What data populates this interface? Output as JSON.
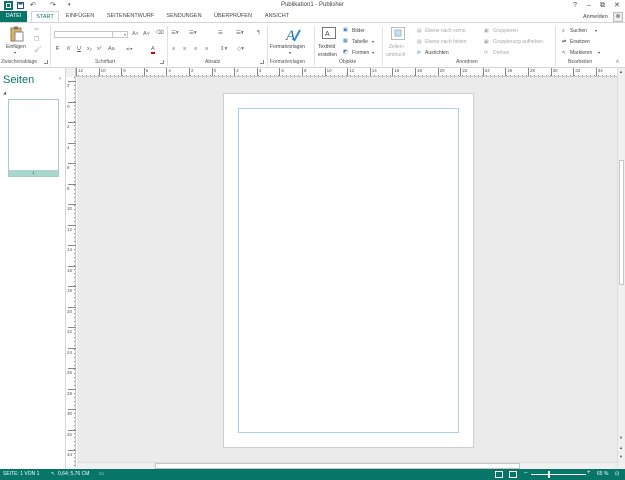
{
  "window": {
    "title": "Publikation1 - Publisher",
    "controls": {
      "help": "?",
      "minimize": "–",
      "restore": "⧉",
      "close": "✕"
    }
  },
  "quick_access": {
    "undo": "↶",
    "redo": "↷",
    "customize": "▾"
  },
  "tabs": [
    {
      "label": "DATEI"
    },
    {
      "label": "START"
    },
    {
      "label": "EINFÜGEN"
    },
    {
      "label": "SEITENENTWURF"
    },
    {
      "label": "SENDUNGEN"
    },
    {
      "label": "ÜBERPRÜFEN"
    },
    {
      "label": "ANSICHT"
    }
  ],
  "account": {
    "signin_label": "Anmelden"
  },
  "ribbon": {
    "clipboard": {
      "paste_label": "Einfügen",
      "group_label": "Zwischenablage"
    },
    "font": {
      "group_label": "Schriftart",
      "grow": "A˄",
      "shrink": "A˅",
      "bold": "F",
      "italic": "K",
      "underline": "U",
      "subscript": "x₂",
      "superscript": "x²",
      "case": "Aa",
      "font_color": "A"
    },
    "paragraph": {
      "group_label": "Absatz",
      "pilcrow": "¶"
    },
    "styles": {
      "label": "Formatvorlagen",
      "group_label": "Formatvorlagen"
    },
    "objects": {
      "group_label": "Objekte",
      "textbox_line1": "Textfeld",
      "textbox_line2": "erstellen",
      "pictures": "Bilder",
      "table": "Tabelle",
      "shapes": "Formen"
    },
    "arrange": {
      "group_label": "Anordnen",
      "wrap_line1": "Zeilen-",
      "wrap_line2": "umbruch",
      "bring_forward": "Ebene nach vorne",
      "send_backward": "Ebene nach hinten",
      "align": "Ausrichten",
      "group": "Gruppieren",
      "ungroup": "Gruppierung aufheben",
      "rotate": "Drehen"
    },
    "editing": {
      "group_label": "Bearbeiten",
      "find": "Suchen",
      "replace": "Ersetzen",
      "select": "Markieren"
    }
  },
  "pages_pane": {
    "title": "Seiten",
    "thumbnail_number": "1"
  },
  "hruler_labels": [
    "12",
    "10",
    "8",
    "6",
    "4",
    "2",
    "0",
    "2",
    "4",
    "6",
    "8",
    "10",
    "12",
    "14",
    "16",
    "18",
    "20",
    "22",
    "24",
    "26",
    "28",
    "30",
    "32",
    "34"
  ],
  "vruler_labels": [
    "2",
    "0",
    "2",
    "4",
    "6",
    "8",
    "10",
    "12",
    "14",
    "16",
    "18",
    "20",
    "22",
    "24",
    "26",
    "28",
    "30",
    "32",
    "34"
  ],
  "status": {
    "page": "SEITE: 1 VON 1",
    "position": "0,64; 5,76 CM",
    "zoom": "65 %",
    "zoom_out": "–",
    "zoom_in": "+"
  },
  "colors": {
    "accent": "#077568",
    "margin_guide": "#a9d3ec",
    "canvas": "#ebebeb"
  }
}
